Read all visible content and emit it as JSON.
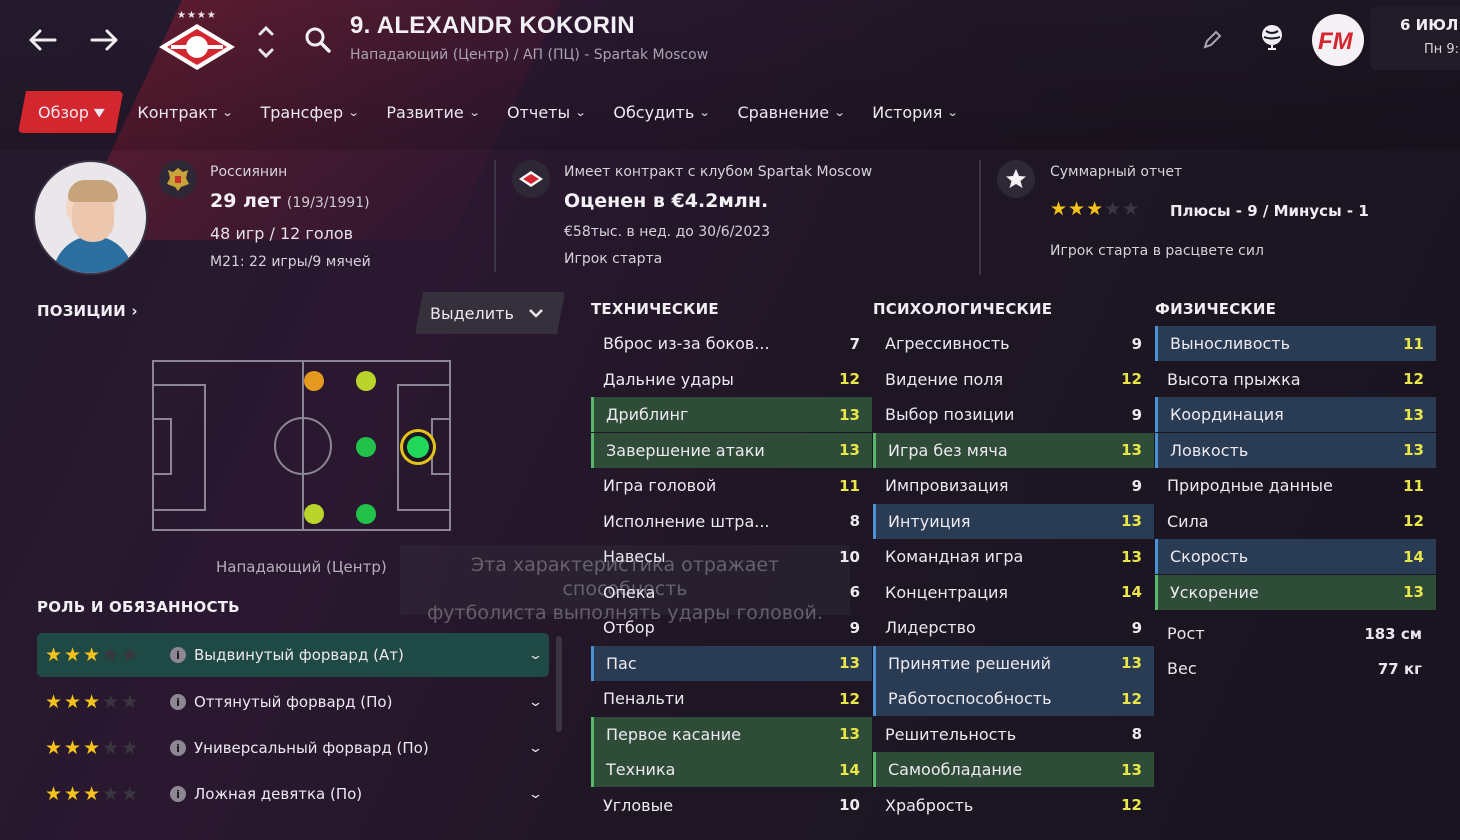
{
  "header": {
    "title": "9. ALEXANDR KOKORIN",
    "subtitle": "Нападающий (Центр) / АП (ПЦ) - Spartak Moscow",
    "club_stars": "★★★★",
    "date_line1": "6 ИЮЛ",
    "date_line2": "Пн 9:"
  },
  "tabs": [
    {
      "label": "Обзор",
      "active": true
    },
    {
      "label": "Контракт"
    },
    {
      "label": "Трансфер"
    },
    {
      "label": "Развитие"
    },
    {
      "label": "Отчеты"
    },
    {
      "label": "Обсудить"
    },
    {
      "label": "Сравнение"
    },
    {
      "label": "История"
    }
  ],
  "info": {
    "nationality": "Россиянин",
    "age": "29 лет",
    "dob": "(19/3/1991)",
    "apps": "48 игр / 12 голов",
    "u21": "М21: 22 игры/9 мячей",
    "contract": "Имеет контракт с клубом Spartak Moscow",
    "value": "Оценен в €4.2млн.",
    "wage": "€58тыс. в нед. до 30/6/2023",
    "status": "Игрок старта",
    "report_title": "Суммарный отчет",
    "report_rating": 3,
    "pros_cons": "Плюсы - 9 / Минусы - 1",
    "report_note": "Игрок старта в расцвете сил"
  },
  "positions": {
    "heading": "ПОЗИЦИИ",
    "select_label": "Выделить",
    "position_label": "Нападающий (Центр)"
  },
  "tooltip": {
    "line1": "Эта характеристика отражает способность",
    "line2": "футболиста выполнять удары головой."
  },
  "roles": {
    "heading": "РОЛЬ И ОБЯЗАННОСТЬ",
    "items": [
      {
        "label": "Выдвинутый форвард (Ат)",
        "stars": 3,
        "selected": true
      },
      {
        "label": "Оттянутый форвард (По)",
        "stars": 3
      },
      {
        "label": "Универсальный форвард (По)",
        "stars": 3
      },
      {
        "label": "Ложная девятка (По)",
        "stars": 3
      }
    ]
  },
  "attributes": {
    "technical": {
      "heading": "ТЕХНИЧЕСКИЕ",
      "items": [
        {
          "name": "Вброс из-за боков...",
          "value": "7"
        },
        {
          "name": "Дальние удары",
          "value": "12"
        },
        {
          "name": "Дриблинг",
          "value": "13",
          "style": "green"
        },
        {
          "name": "Завершение атаки",
          "value": "13",
          "style": "green"
        },
        {
          "name": "Игра головой",
          "value": "11"
        },
        {
          "name": "Исполнение штра...",
          "value": "8"
        },
        {
          "name": "Навесы",
          "value": "10"
        },
        {
          "name": "Опека",
          "value": "6"
        },
        {
          "name": "Отбор",
          "value": "9"
        },
        {
          "name": "Пас",
          "value": "13",
          "style": "blue"
        },
        {
          "name": "Пенальти",
          "value": "12"
        },
        {
          "name": "Первое касание",
          "value": "13",
          "style": "green"
        },
        {
          "name": "Техника",
          "value": "14",
          "style": "green"
        },
        {
          "name": "Угловые",
          "value": "10"
        }
      ]
    },
    "mental": {
      "heading": "ПСИХОЛОГИЧЕСКИЕ",
      "items": [
        {
          "name": "Агрессивность",
          "value": "9"
        },
        {
          "name": "Видение поля",
          "value": "12"
        },
        {
          "name": "Выбор позиции",
          "value": "9"
        },
        {
          "name": "Игра без мяча",
          "value": "13",
          "style": "green"
        },
        {
          "name": "Импровизация",
          "value": "9"
        },
        {
          "name": "Интуиция",
          "value": "13",
          "style": "blue"
        },
        {
          "name": "Командная игра",
          "value": "13"
        },
        {
          "name": "Концентрация",
          "value": "14"
        },
        {
          "name": "Лидерство",
          "value": "9"
        },
        {
          "name": "Принятие решений",
          "value": "13",
          "style": "blue"
        },
        {
          "name": "Работоспособность",
          "value": "12",
          "style": "blue"
        },
        {
          "name": "Решительность",
          "value": "8"
        },
        {
          "name": "Самообладание",
          "value": "13",
          "style": "green"
        },
        {
          "name": "Храбрость",
          "value": "12"
        }
      ]
    },
    "physical": {
      "heading": "ФИЗИЧЕСКИЕ",
      "items": [
        {
          "name": "Выносливость",
          "value": "11",
          "style": "blue"
        },
        {
          "name": "Высота прыжка",
          "value": "12"
        },
        {
          "name": "Координация",
          "value": "13",
          "style": "blue"
        },
        {
          "name": "Ловкость",
          "value": "13",
          "style": "blue"
        },
        {
          "name": "Природные данные",
          "value": "11"
        },
        {
          "name": "Сила",
          "value": "12"
        },
        {
          "name": "Скорость",
          "value": "14",
          "style": "blue"
        },
        {
          "name": "Ускорение",
          "value": "13",
          "style": "green"
        }
      ],
      "height_label": "Рост",
      "height": "183 см",
      "weight_label": "Вес",
      "weight": "77 кг"
    }
  },
  "colors": {
    "accent": "#d4262e",
    "star": "#f4c21a",
    "green_row": "#2e4c37",
    "blue_row": "#2a3c54"
  }
}
